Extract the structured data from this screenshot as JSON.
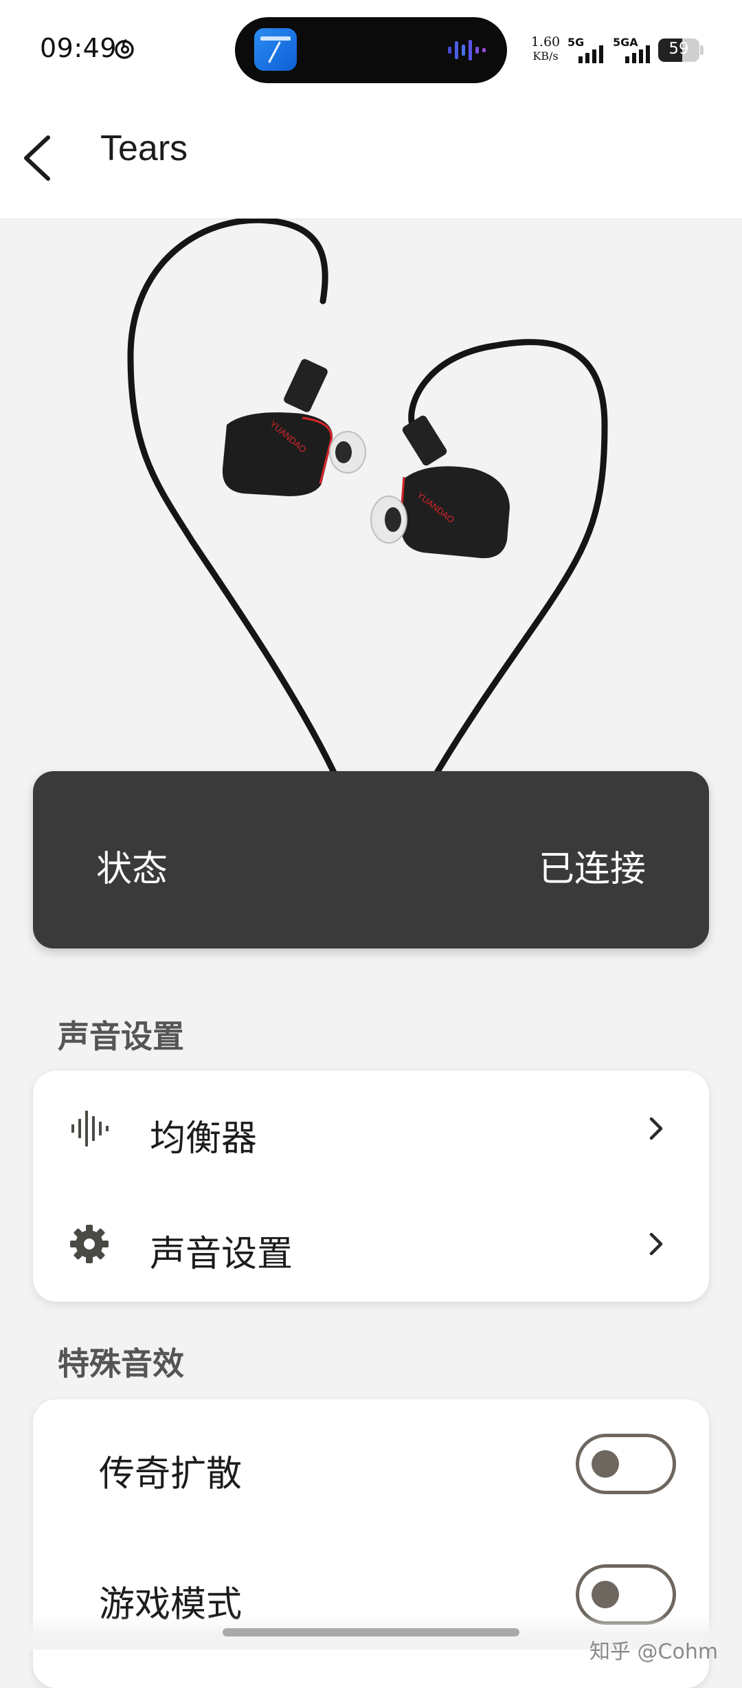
{
  "status_bar": {
    "time": "09:49",
    "net_speed_value": "1.60",
    "net_speed_unit": "KB/s",
    "sim1_label": "5G",
    "sim2_label": "5GA",
    "battery_level": "59",
    "battery_fraction": 0.59,
    "icons": [
      "netease-music-icon",
      "maps-app-icon",
      "audio-wave-icon",
      "signal-icon",
      "battery-icon"
    ]
  },
  "header": {
    "back_icon": "back-arrow-icon",
    "title": "Tears"
  },
  "product_image": {
    "brand_text": "YUANDAO"
  },
  "status_card": {
    "label": "状态",
    "value": "已连接",
    "background": "#3a3a3a"
  },
  "sound_section": {
    "title": "声音设置",
    "items": [
      {
        "label": "均衡器",
        "icon": "equalizer-icon"
      },
      {
        "label": "声音设置",
        "icon": "gear-icon"
      }
    ]
  },
  "effects_section": {
    "title": "特殊音效",
    "items": [
      {
        "label": "传奇扩散",
        "enabled": false
      },
      {
        "label": "游戏模式",
        "enabled": false
      }
    ]
  },
  "watermark": "知乎 @Cohm",
  "colors": {
    "accent_toggle": "#6d675f",
    "page_background": "#f3f3f3",
    "brand_red": "#d8262b"
  }
}
